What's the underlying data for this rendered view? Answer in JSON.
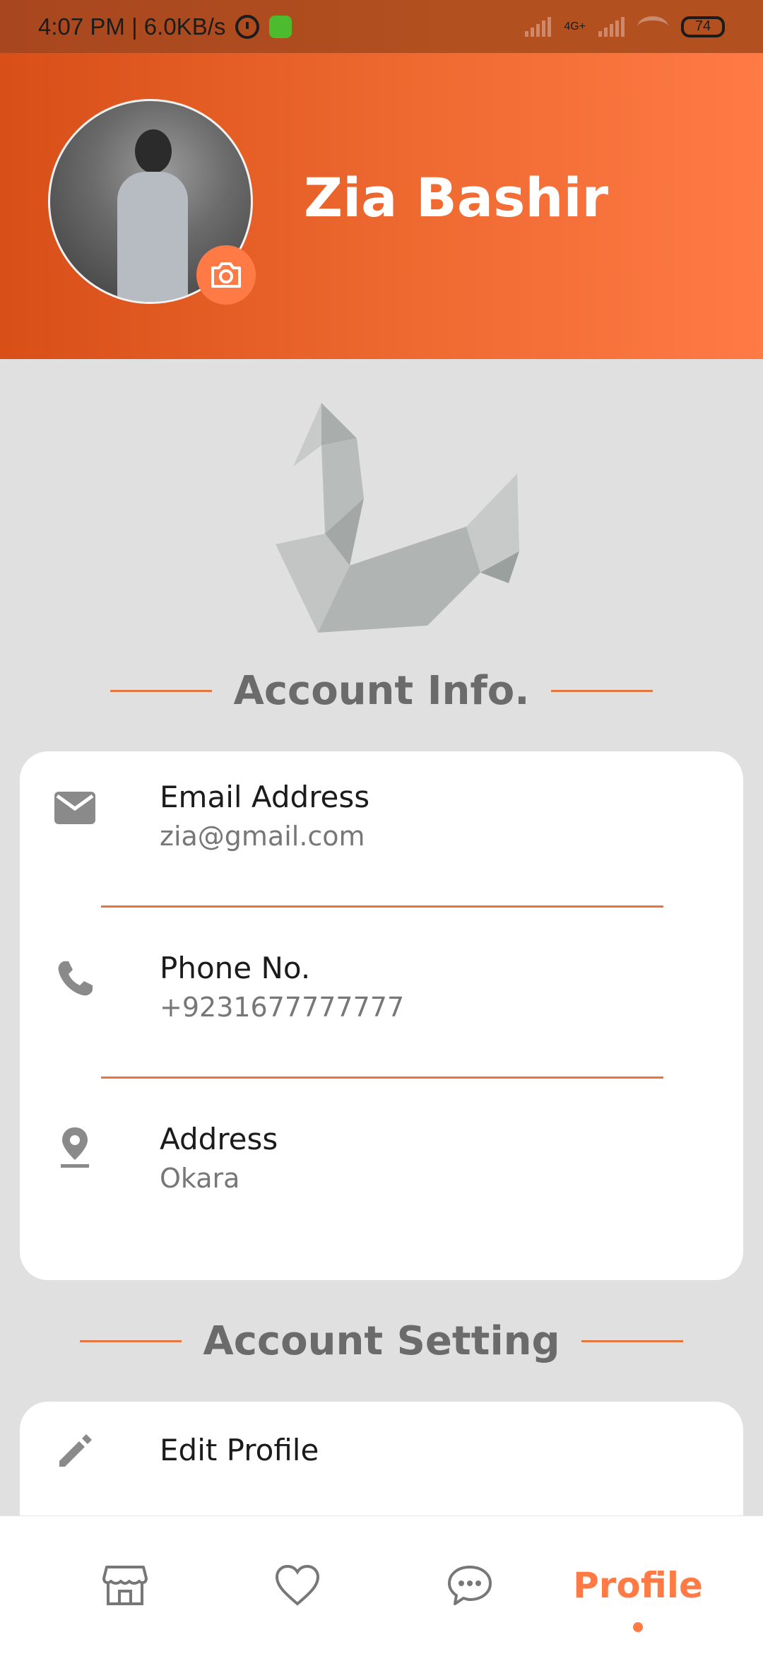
{
  "status_bar": {
    "time_speed": "4:07 PM | 6.0KB/s",
    "network_label": "4G+",
    "battery_level": "74"
  },
  "header": {
    "profile_name": "Zia Bashir"
  },
  "sections": {
    "account_info_title": "Account Info.",
    "account_setting_title": "Account Setting"
  },
  "account_info": [
    {
      "label": "Email Address",
      "value": "zia@gmail.com",
      "icon": "mail-icon"
    },
    {
      "label": "Phone No.",
      "value": "+9231677777777",
      "icon": "phone-icon"
    },
    {
      "label": "Address",
      "value": "Okara",
      "icon": "location-pin-icon"
    }
  ],
  "account_setting": [
    {
      "label": "Edit Profile",
      "icon": "pencil-icon"
    }
  ],
  "bottom_nav": {
    "items": [
      "store-icon",
      "heart-icon",
      "chat-icon"
    ],
    "active_label": "Profile"
  },
  "colors": {
    "accent": "#ff7a45",
    "header_start": "#d84f18",
    "divider": "#e3773f",
    "background": "#e0e0e0"
  }
}
